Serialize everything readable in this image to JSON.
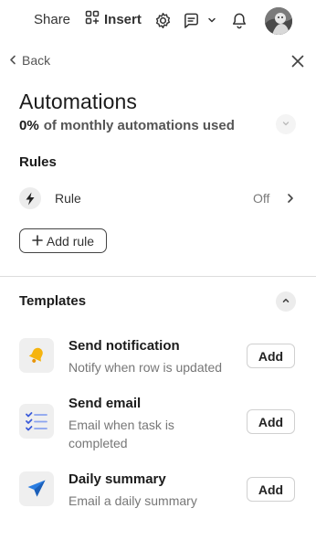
{
  "toolbar": {
    "share_label": "Share",
    "insert_label": "Insert"
  },
  "nav": {
    "back_label": "Back"
  },
  "panel": {
    "title": "Automations",
    "usage_percent": "0%",
    "usage_text": "of monthly automations used"
  },
  "rules": {
    "section_title": "Rules",
    "items": [
      {
        "label": "Rule",
        "status": "Off"
      }
    ],
    "add_label": "Add rule"
  },
  "templates": {
    "section_title": "Templates",
    "items": [
      {
        "title": "Send notification",
        "description": "Notify when row is updated",
        "add_label": "Add",
        "icon": "bell-icon"
      },
      {
        "title": "Send email",
        "description": "Email when task is completed",
        "add_label": "Add",
        "icon": "checklist-icon"
      },
      {
        "title": "Daily summary",
        "description": "Email a daily summary",
        "add_label": "Add",
        "icon": "paper-plane-icon"
      }
    ]
  },
  "colors": {
    "bell": "#f5b40f",
    "checklist": "#3b5bd9",
    "plane": "#2a7de1",
    "text_primary": "#1b1b1b",
    "text_muted": "#777777"
  }
}
